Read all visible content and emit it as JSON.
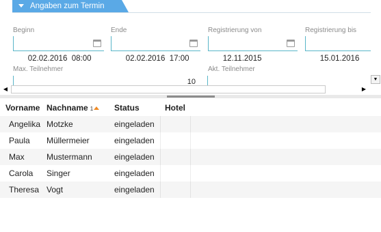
{
  "section": {
    "title": "Angaben zum Termin"
  },
  "fields": {
    "beginn": {
      "label": "Beginn",
      "value": "02.02.2016  08:00"
    },
    "ende": {
      "label": "Ende",
      "value": "02.02.2016  17:00"
    },
    "reg_von": {
      "label": "Registrierung von",
      "value": "12.11.2015"
    },
    "reg_bis": {
      "label": "Registrierung bis",
      "value": "15.01.2016"
    },
    "max_teilnehmer": {
      "label": "Max. Teilnehmer",
      "value": "10"
    },
    "akt_teilnehmer": {
      "label": "Akt. Teilnehmer",
      "value": ""
    }
  },
  "table": {
    "columns": {
      "vorname": "Vorname",
      "nachname": "Nachname",
      "status": "Status",
      "hotel": "Hotel"
    },
    "sort_index": "1",
    "rows": [
      {
        "vorname": "Angelika",
        "nachname": "Motzke",
        "status": "eingeladen",
        "hotel": ""
      },
      {
        "vorname": "Paula",
        "nachname": "Müllermeier",
        "status": "eingeladen",
        "hotel": ""
      },
      {
        "vorname": "Max",
        "nachname": "Mustermann",
        "status": "eingeladen",
        "hotel": ""
      },
      {
        "vorname": "Carola",
        "nachname": "Singer",
        "status": "eingeladen",
        "hotel": ""
      },
      {
        "vorname": "Theresa",
        "nachname": "Vogt",
        "status": "eingeladen",
        "hotel": ""
      }
    ]
  },
  "colors": {
    "accent": "#5aa9e6",
    "field_border": "#58b5c8",
    "sort_indicator": "#f08a24"
  }
}
